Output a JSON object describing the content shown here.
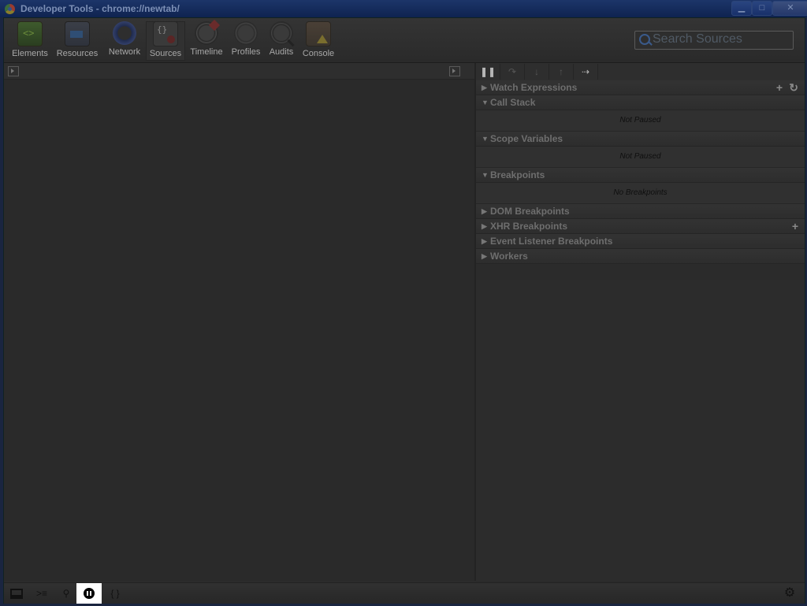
{
  "window": {
    "title": "Developer Tools - chrome://newtab/",
    "buttons": {
      "minimize": "▁",
      "maximize": "□",
      "close": "✕"
    }
  },
  "toolbar": {
    "tools": [
      {
        "label": "Elements",
        "icon": "elements-icon"
      },
      {
        "label": "Resources",
        "icon": "resources-icon"
      },
      {
        "label": "Network",
        "icon": "network-icon"
      },
      {
        "label": "Sources",
        "icon": "sources-icon",
        "selected": true
      },
      {
        "label": "Timeline",
        "icon": "timeline-icon"
      },
      {
        "label": "Profiles",
        "icon": "profiles-icon"
      },
      {
        "label": "Audits",
        "icon": "audits-icon"
      },
      {
        "label": "Console",
        "icon": "console-icon"
      }
    ],
    "search_placeholder": "Search Sources"
  },
  "debugger": {
    "controls": [
      {
        "name": "pause-icon",
        "glyph": "❚❚",
        "active": true
      },
      {
        "name": "step-over-icon",
        "glyph": "↷",
        "active": false
      },
      {
        "name": "step-into-icon",
        "glyph": "↓",
        "active": false
      },
      {
        "name": "step-out-icon",
        "glyph": "↑",
        "active": false
      },
      {
        "name": "deactivate-breakpoints-icon",
        "glyph": "⇢",
        "active": true
      }
    ],
    "sections": {
      "watch": {
        "title": "Watch Expressions",
        "add": "+",
        "refresh": "↻"
      },
      "call_stack": {
        "title": "Call Stack",
        "body": "Not Paused"
      },
      "scope": {
        "title": "Scope Variables",
        "body": "Not Paused"
      },
      "breakpoints": {
        "title": "Breakpoints",
        "body": "No Breakpoints"
      },
      "dom_breakpoints": {
        "title": "DOM Breakpoints"
      },
      "xhr_breakpoints": {
        "title": "XHR Breakpoints",
        "add": "+"
      },
      "event_listener_breakpoints": {
        "title": "Event Listener Breakpoints"
      },
      "workers": {
        "title": "Workers"
      }
    }
  },
  "statusbar": {
    "brace_label": "{ }",
    "gear": "⚙"
  }
}
